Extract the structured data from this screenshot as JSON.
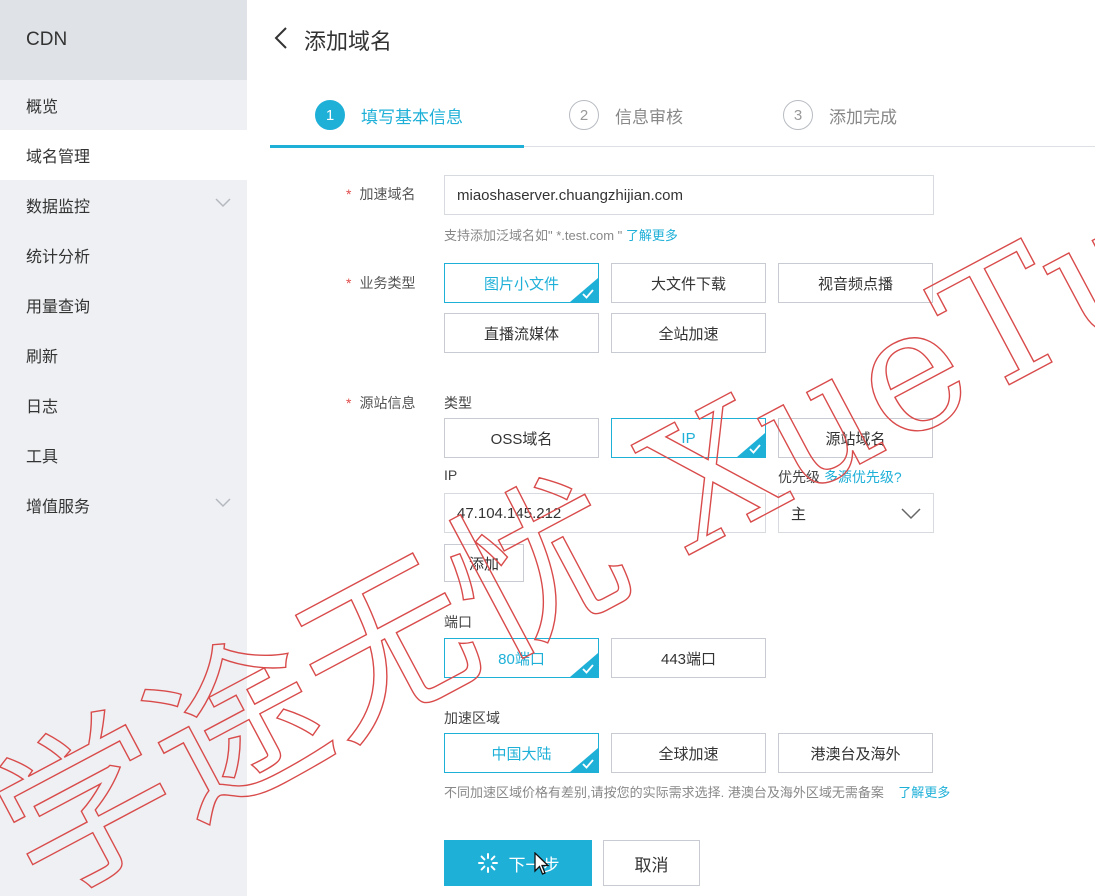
{
  "sidebar": {
    "title": "CDN",
    "items": [
      {
        "label": "概览"
      },
      {
        "label": "域名管理"
      },
      {
        "label": "数据监控"
      },
      {
        "label": "统计分析"
      },
      {
        "label": "用量查询"
      },
      {
        "label": "刷新"
      },
      {
        "label": "日志"
      },
      {
        "label": "工具"
      },
      {
        "label": "增值服务"
      }
    ]
  },
  "header": {
    "title": "添加域名"
  },
  "steps": [
    {
      "num": "1",
      "label": "填写基本信息"
    },
    {
      "num": "2",
      "label": "信息审核"
    },
    {
      "num": "3",
      "label": "添加完成"
    }
  ],
  "form": {
    "domain": {
      "label": "加速域名",
      "value": "miaoshaserver.chuangzhijian.com",
      "hint_prefix": "支持添加泛域名如\" *.test.com \"",
      "hint_link": "了解更多"
    },
    "biz_type": {
      "label": "业务类型",
      "options": [
        "图片小文件",
        "大文件下载",
        "视音频点播",
        "直播流媒体",
        "全站加速"
      ]
    },
    "origin": {
      "label": "源站信息",
      "type_label": "类型",
      "type_options": [
        "OSS域名",
        "IP",
        "源站域名"
      ],
      "ip_label": "IP",
      "priority_label": "优先级",
      "priority_link": "多源优先级?",
      "ip_value": "47.104.145.212",
      "priority_value": "主",
      "add_button": "添加"
    },
    "port": {
      "label": "端口",
      "options": [
        "80端口",
        "443端口"
      ]
    },
    "region": {
      "label": "加速区域",
      "options": [
        "中国大陆",
        "全球加速",
        "港澳台及海外"
      ],
      "hint": "不同加速区域价格有差别,请按您的实际需求选择. 港澳台及海外区域无需备案",
      "hint_link": "了解更多"
    }
  },
  "buttons": {
    "next": "下一步",
    "cancel": "取消"
  },
  "watermark": {
    "text": "学途无忧 XueTu"
  },
  "colors": {
    "accent": "#1fb0d8",
    "sidebar_bg": "#eef0f3",
    "required": "#e04c4c"
  }
}
